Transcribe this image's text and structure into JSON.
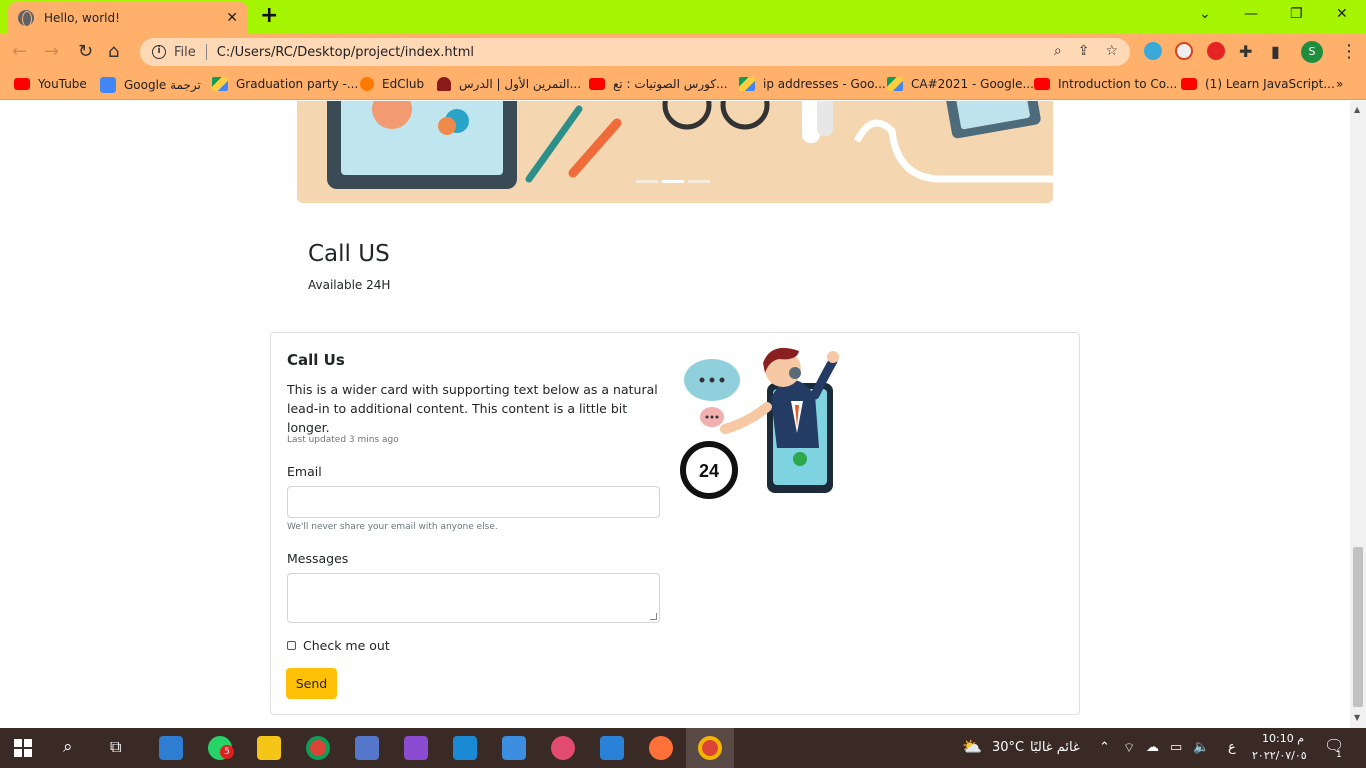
{
  "browser": {
    "tab": {
      "title": "Hello, world!",
      "close": "✕",
      "new_tab": "+"
    },
    "window_controls": {
      "minimize": "—",
      "restore": "❐",
      "close": "✕",
      "chevron": "⌄"
    },
    "omnibox": {
      "info": "i",
      "scheme_label": "File",
      "url": "C:/Users/RC/Desktop/project/index.html"
    },
    "bookmarks": [
      {
        "label": "YouTube",
        "icon": "youtube-icon"
      },
      {
        "label": "Google ترجمة",
        "icon": "google-translate-icon"
      },
      {
        "label": "Graduation party -...",
        "icon": "google-drive-icon"
      },
      {
        "label": "EdClub",
        "icon": "edclub-icon"
      },
      {
        "label": "التمرين الأول | الدرس...",
        "icon": "hat-icon"
      },
      {
        "label": "كورس الصوتيات : تع...",
        "icon": "youtube-icon"
      },
      {
        "label": "ip addresses - Goo...",
        "icon": "google-drive-icon"
      },
      {
        "label": "CA#2021 - Google...",
        "icon": "google-drive-icon"
      },
      {
        "label": "Introduction to Co...",
        "icon": "youtube-icon"
      },
      {
        "label": "(1) Learn JavaScript...",
        "icon": "youtube-icon"
      }
    ],
    "more_bookmarks": "»",
    "profile_initial": "S"
  },
  "page": {
    "call_section": {
      "heading": "Call US",
      "subtext": "Available 24H"
    },
    "card": {
      "title": "Call Us",
      "text": "This is a wider card with supporting text below as a natural lead-in to additional content. This content is a little bit longer.",
      "updated": "Last updated 3 mins ago",
      "email_label": "Email",
      "email_value": "",
      "email_help": "We'll never share your email with anyone else.",
      "messages_label": "Messages",
      "messages_value": "",
      "checkbox_label": "Check me out",
      "checkbox_checked": false,
      "send_label": "Send"
    },
    "illustration": {
      "clock_text": "24"
    }
  },
  "taskbar": {
    "whatsapp_badge": "5",
    "weather": {
      "temp": "30°C",
      "condition": "غائم غالبًا"
    },
    "language": "ع",
    "time": "10:10 م",
    "date": "٢٠٢٢/٠٧/٠٥",
    "notification_count": "1"
  },
  "colors": {
    "tab_strip": "#a6f500",
    "toolbar": "#ffb06b",
    "send_button": "#ffc107"
  }
}
